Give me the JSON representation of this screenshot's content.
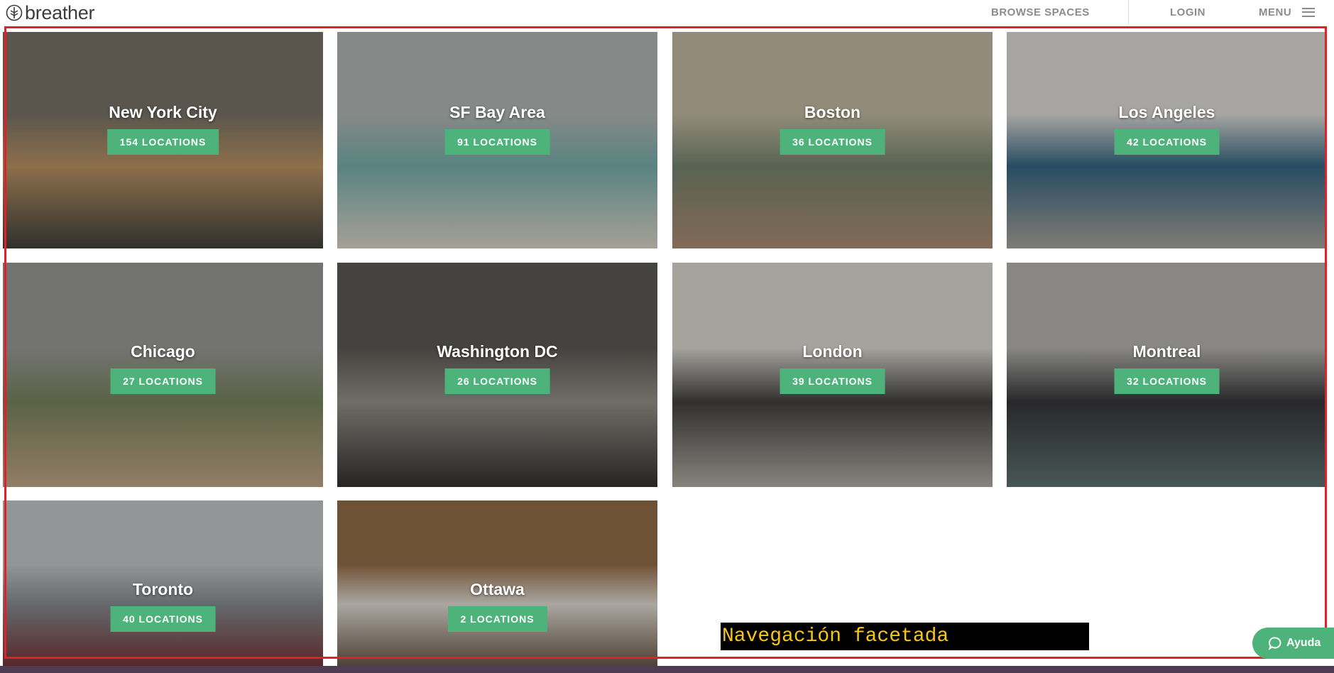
{
  "header": {
    "logo_text": "breather",
    "nav_browse": "BROWSE SPACES",
    "nav_login": "LOGIN",
    "nav_menu": "MENU"
  },
  "cities": [
    {
      "name": "New York City",
      "locations": "154 LOCATIONS",
      "palette": [
        "#6f6a5e",
        "#b08a5c",
        "#3a3a36"
      ]
    },
    {
      "name": "SF Bay Area",
      "locations": "91 LOCATIONS",
      "palette": [
        "#a6acaa",
        "#6ea3a0",
        "#cfc9bd"
      ]
    },
    {
      "name": "Boston",
      "locations": "36 LOCATIONS",
      "palette": [
        "#b7ae98",
        "#6d7a64",
        "#a3836a"
      ]
    },
    {
      "name": "Los Angeles",
      "locations": "42 LOCATIONS",
      "palette": [
        "#d0cfc9",
        "#2f5d79",
        "#9e9a92"
      ]
    },
    {
      "name": "Chicago",
      "locations": "27 LOCATIONS",
      "palette": [
        "#8f8f8c",
        "#6f7a55",
        "#b79c7e"
      ]
    },
    {
      "name": "Washington DC",
      "locations": "26 LOCATIONS",
      "palette": [
        "#54514d",
        "#8a8780",
        "#2d2b2a"
      ]
    },
    {
      "name": "London",
      "locations": "39 LOCATIONS",
      "palette": [
        "#cfccc6",
        "#3a3937",
        "#a8a49d"
      ]
    },
    {
      "name": "Montreal",
      "locations": "32 LOCATIONS",
      "palette": [
        "#a9a8a4",
        "#2f2f31",
        "#566b68"
      ]
    },
    {
      "name": "Toronto",
      "locations": "40 LOCATIONS",
      "palette": [
        "#b8bcbc",
        "#7d8286",
        "#6b2b2e"
      ]
    },
    {
      "name": "Ottawa",
      "locations": "2 LOCATIONS",
      "palette": [
        "#8a6440",
        "#d6d1c8",
        "#5b4a3b"
      ]
    }
  ],
  "caption": "Navegación facetada",
  "help_button": "Ayuda",
  "colors": {
    "accent_green": "#4db37a",
    "frame_red": "#e0212b",
    "caption_yellow": "#f5c518"
  }
}
